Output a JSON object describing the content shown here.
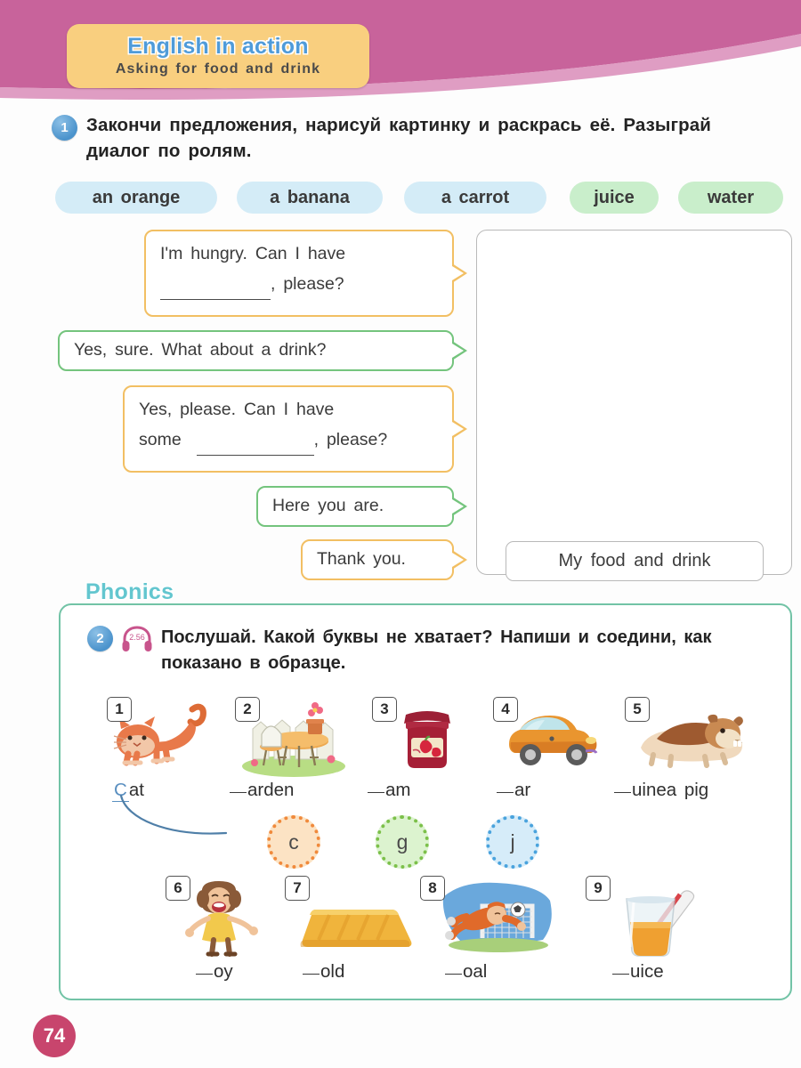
{
  "header": {
    "title": "English in action",
    "subtitle": "Asking for food and drink",
    "banner_color": "#c8639b",
    "badge_color": "#f9cf7f",
    "title_color": "#4f9bd9"
  },
  "exercise1": {
    "number": "1",
    "instruction": "Закончи предложения, нарисуй картинку и раскрась её. Разыграй диалог по ролям.",
    "chips": [
      {
        "label": "an orange",
        "color": "#d4ecf7",
        "kind": "blue"
      },
      {
        "label": "a banana",
        "color": "#d4ecf7",
        "kind": "blue"
      },
      {
        "label": "a carrot",
        "color": "#d4ecf7",
        "kind": "blue"
      },
      {
        "label": "juice",
        "color": "#c9eecb",
        "kind": "green"
      },
      {
        "label": "water",
        "color": "#c9eecb",
        "kind": "green"
      }
    ],
    "dialogue": [
      {
        "line1": "I'm hungry.  Can  I  have",
        "line2_pre": "",
        "line2_post": ",  please?",
        "has_blank": true,
        "color": "orange"
      },
      {
        "line1": "Yes,  sure.  What  about  a  drink?",
        "has_blank": false,
        "color": "green"
      },
      {
        "line1": "Yes,  please.  Can  I  have",
        "line2_pre": "some",
        "line2_post": ",  please?",
        "has_blank": true,
        "color": "orange"
      },
      {
        "line1": "Here  you  are.",
        "has_blank": false,
        "color": "green"
      },
      {
        "line1": "Thank  you.",
        "has_blank": false,
        "color": "orange"
      }
    ],
    "drawing_label": "My  food  and  drink"
  },
  "phonics": {
    "tab_label": "Phonics",
    "tab_color": "#63c6cf",
    "border_color": "#72c3a6",
    "exercise": {
      "number": "2",
      "audio_track": "2.56",
      "instruction": "Послушай. Какой буквы не хватает? Напиши и соедини, как показано в образце."
    },
    "items_row1": [
      {
        "number": "1",
        "picture": "cat-icon",
        "word_gap": "C",
        "word_rest": "at",
        "answered": true
      },
      {
        "number": "2",
        "picture": "garden-icon",
        "word_gap": "",
        "word_rest": "arden",
        "answered": false
      },
      {
        "number": "3",
        "picture": "jam-jar-icon",
        "word_gap": "",
        "word_rest": "am",
        "answered": false
      },
      {
        "number": "4",
        "picture": "car-icon",
        "word_gap": "",
        "word_rest": "ar",
        "answered": false
      },
      {
        "number": "5",
        "picture": "guinea-pig-icon",
        "word_gap": "",
        "word_rest": "uinea  pig",
        "answered": false
      }
    ],
    "letters": [
      {
        "letter": "c",
        "color": "#f08a3c",
        "fill": "#fce3c4"
      },
      {
        "letter": "g",
        "color": "#7cc04a",
        "fill": "#dcf3cf"
      },
      {
        "letter": "j",
        "color": "#4aa3dd",
        "fill": "#d6ecf9"
      }
    ],
    "items_row2": [
      {
        "number": "6",
        "picture": "girl-joy-icon",
        "word_gap": "",
        "word_rest": "oy",
        "answered": false
      },
      {
        "number": "7",
        "picture": "gold-bar-icon",
        "word_gap": "",
        "word_rest": "old",
        "answered": false
      },
      {
        "number": "8",
        "picture": "goal-keeper-icon",
        "word_gap": "",
        "word_rest": "oal",
        "answered": false
      },
      {
        "number": "9",
        "picture": "juice-glass-icon",
        "word_gap": "",
        "word_rest": "uice",
        "answered": false
      }
    ]
  },
  "footer": {
    "page_number": "74",
    "page_number_color": "#c8456d"
  }
}
